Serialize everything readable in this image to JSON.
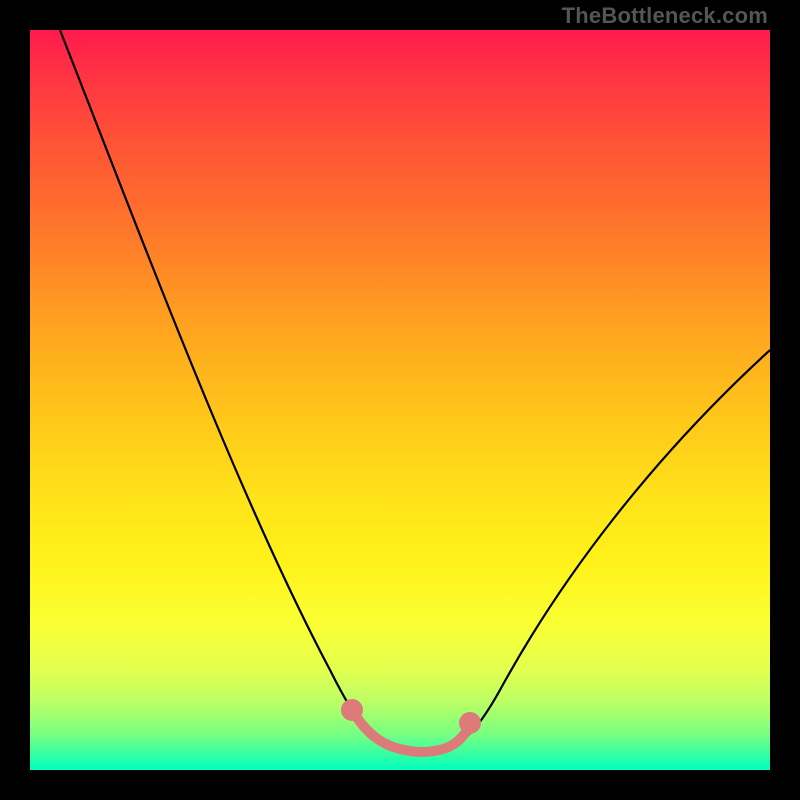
{
  "watermark": {
    "text": "TheBottleneck.com"
  },
  "chart_data": {
    "type": "line",
    "title": "",
    "xlabel": "",
    "ylabel": "",
    "xlim": [
      0,
      100
    ],
    "ylim": [
      0,
      100
    ],
    "x": [
      0,
      5,
      10,
      15,
      20,
      25,
      30,
      35,
      40,
      42,
      45,
      48,
      51,
      54,
      57,
      59,
      62,
      66,
      70,
      75,
      80,
      85,
      90,
      95,
      100
    ],
    "values": [
      100,
      89,
      78,
      67,
      56,
      45,
      35,
      25,
      15,
      10,
      6,
      3,
      1,
      0.5,
      0.5,
      1,
      3,
      7,
      12,
      18,
      25,
      33,
      41,
      49,
      57
    ],
    "annotations": [
      {
        "type": "circle",
        "x": 42,
        "y": 10,
        "color": "#e06666",
        "r": 5
      },
      {
        "type": "circle",
        "x": 59,
        "y": 10,
        "color": "#e06666",
        "r": 5
      },
      {
        "type": "segment",
        "x1": 45,
        "y1": 6,
        "x2": 57,
        "y2": 6,
        "color": "#e06666",
        "width": 8
      }
    ],
    "background": "rainbow-vertical-gradient",
    "frame": "black"
  }
}
